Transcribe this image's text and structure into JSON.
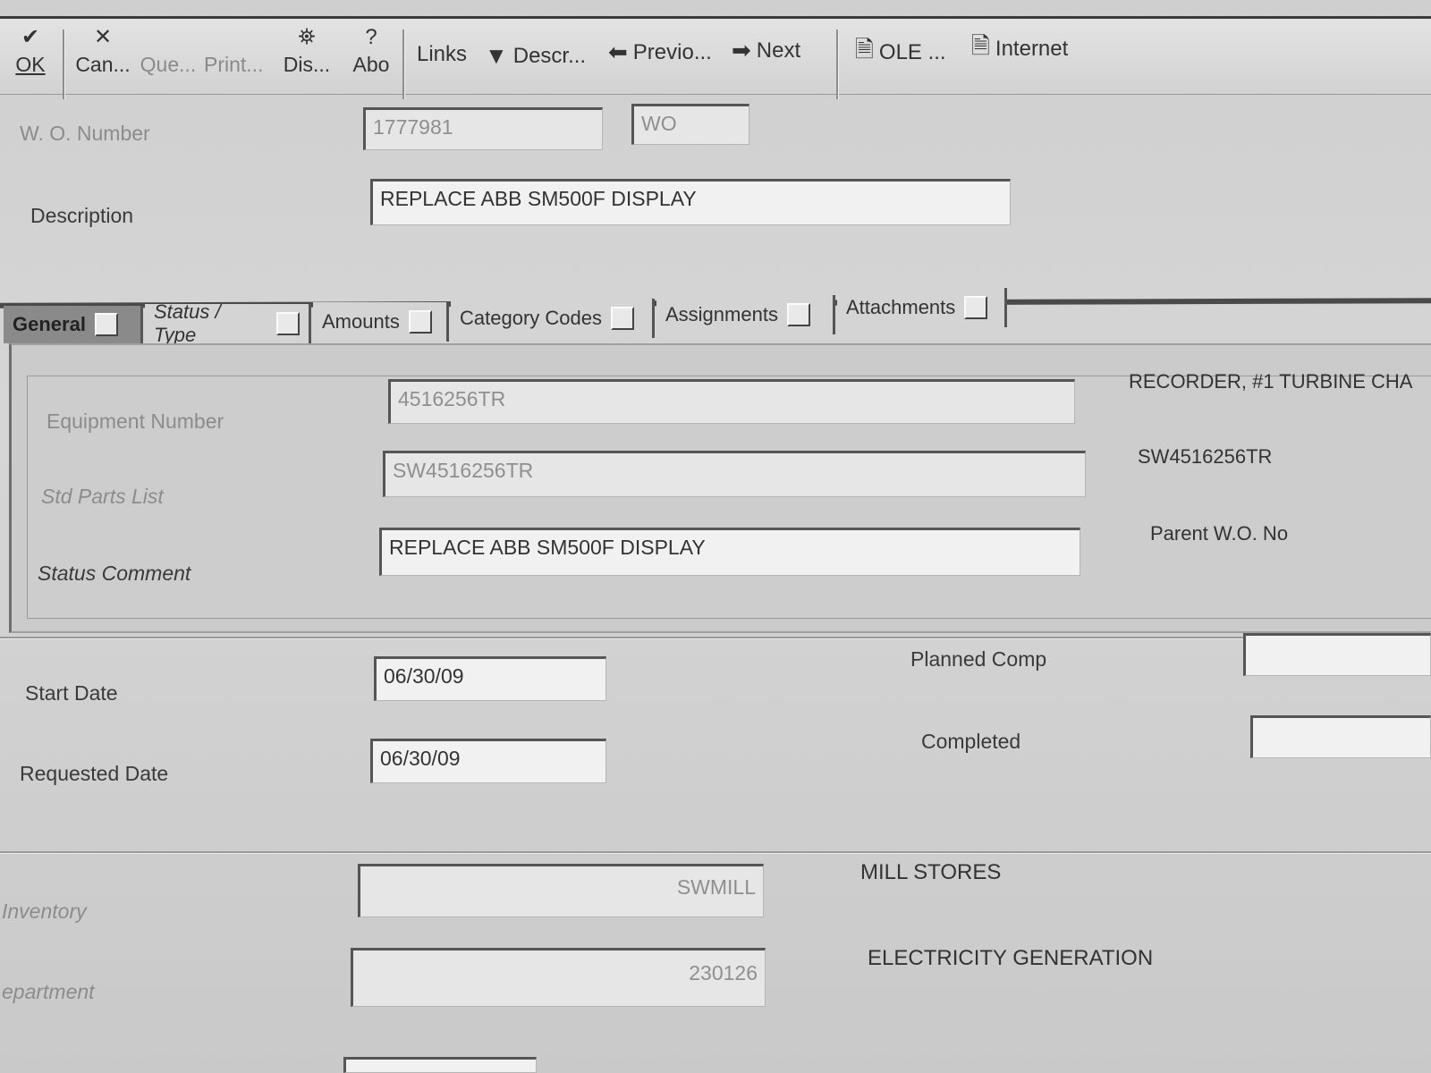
{
  "toolbar": {
    "ok": "OK",
    "cancel": "Can...",
    "query": "Que...",
    "print": "Print...",
    "display": "Dis...",
    "about": "Abo",
    "links": "Links",
    "descr": "Descr...",
    "previous": "Previo...",
    "next": "Next",
    "ole": "OLE ...",
    "internet": "Internet"
  },
  "header": {
    "wo_number_label": "W. O. Number",
    "wo_number_value": "1777981",
    "wo_type_value": "WO",
    "description_label": "Description",
    "description_value": "REPLACE ABB SM500F DISPLAY"
  },
  "tabs": [
    {
      "label": "General"
    },
    {
      "label": "Status / Type"
    },
    {
      "label": "Amounts"
    },
    {
      "label": "Category Codes"
    },
    {
      "label": "Assignments"
    },
    {
      "label": "Attachments"
    }
  ],
  "general": {
    "equipment_number_label": "Equipment Number",
    "equipment_number_value": "4516256TR",
    "equipment_desc": "RECORDER, #1 TURBINE CHA",
    "std_parts_label": "Std Parts List",
    "std_parts_value": "SW4516256TR",
    "std_parts_desc": "SW4516256TR",
    "status_comment_label": "Status Comment",
    "status_comment_value": "REPLACE ABB SM500F DISPLAY",
    "parent_wo_label": "Parent W.O. No"
  },
  "dates": {
    "start_label": "Start Date",
    "start_value": "06/30/09",
    "requested_label": "Requested Date",
    "requested_value": "06/30/09",
    "planned_comp_label": "Planned Comp",
    "planned_comp_value": "",
    "completed_label": "Completed",
    "completed_value": ""
  },
  "org": {
    "inventory_label": "Inventory",
    "inventory_value": "SWMILL",
    "inventory_desc": "MILL STORES",
    "department_label": "epartment",
    "department_value": "230126",
    "department_desc": "ELECTRICITY GENERATION"
  }
}
